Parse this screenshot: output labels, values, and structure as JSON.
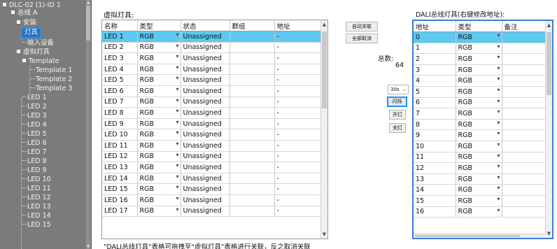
{
  "tree": {
    "root": "DLC-02 (1)-ID 1",
    "bus": "总线 A",
    "install": "安装",
    "fixture": "灯具",
    "input_device": "输入设备",
    "virtual_fixture": "虚拟灯具",
    "template": "Template",
    "templates": [
      "Template 1",
      "Template 2",
      "Template 3"
    ],
    "leds": [
      "LED 1",
      "LED 2",
      "LED 3",
      "LED 4",
      "LED 5",
      "LED 6",
      "LED 7",
      "LED 8",
      "LED 9",
      "LED 10",
      "LED 11",
      "LED 12",
      "LED 13",
      "LED 14",
      "LED 15"
    ]
  },
  "virtual_table": {
    "title": "虚拟灯具",
    "columns": [
      "名称",
      "类型",
      "状态",
      "群组",
      "地址"
    ],
    "rows": [
      {
        "name": "LED 1",
        "type": "RGB",
        "status": "Unassigned",
        "group": "",
        "address": "-"
      },
      {
        "name": "LED 2",
        "type": "RGB",
        "status": "Unassigned",
        "group": "",
        "address": "-"
      },
      {
        "name": "LED 3",
        "type": "RGB",
        "status": "Unassigned",
        "group": "",
        "address": "-"
      },
      {
        "name": "LED 4",
        "type": "RGB",
        "status": "Unassigned",
        "group": "",
        "address": "-"
      },
      {
        "name": "LED 5",
        "type": "RGB",
        "status": "Unassigned",
        "group": "",
        "address": "-"
      },
      {
        "name": "LED 6",
        "type": "RGB",
        "status": "Unassigned",
        "group": "",
        "address": "-"
      },
      {
        "name": "LED 7",
        "type": "RGB",
        "status": "Unassigned",
        "group": "",
        "address": "-"
      },
      {
        "name": "LED 8",
        "type": "RGB",
        "status": "Unassigned",
        "group": "",
        "address": "-"
      },
      {
        "name": "LED 9",
        "type": "RGB",
        "status": "Unassigned",
        "group": "",
        "address": "-"
      },
      {
        "name": "LED 10",
        "type": "RGB",
        "status": "Unassigned",
        "group": "",
        "address": "-"
      },
      {
        "name": "LED 11",
        "type": "RGB",
        "status": "Unassigned",
        "group": "",
        "address": "-"
      },
      {
        "name": "LED 12",
        "type": "RGB",
        "status": "Unassigned",
        "group": "",
        "address": "-"
      },
      {
        "name": "LED 13",
        "type": "RGB",
        "status": "Unassigned",
        "group": "",
        "address": "-"
      },
      {
        "name": "LED 14",
        "type": "RGB",
        "status": "Unassigned",
        "group": "",
        "address": "-"
      },
      {
        "name": "LED 15",
        "type": "RGB",
        "status": "Unassigned",
        "group": "",
        "address": "-"
      },
      {
        "name": "LED 16",
        "type": "RGB",
        "status": "Unassigned",
        "group": "",
        "address": "-"
      },
      {
        "name": "LED 17",
        "type": "RGB",
        "status": "Unassigned",
        "group": "",
        "address": "-"
      }
    ]
  },
  "footer_note": "\"DALI总线灯具\"表格可拖拽至\"虚拟灯具\"表格进行关联，反之取消关联",
  "controls": {
    "auto_link": "自动关联",
    "cancel_all": "全部取消",
    "total_label": "总数:",
    "total_value": "64",
    "interval": "30s",
    "flash": "闪烁",
    "turn_on": "开灯",
    "turn_off": "关灯"
  },
  "dali_table": {
    "title": "DALI总线灯具(右键修改地址):",
    "columns": [
      "地址",
      "类型",
      "备注"
    ],
    "rows": [
      {
        "address": "0",
        "type": "RGB",
        "note": ""
      },
      {
        "address": "1",
        "type": "RGB",
        "note": ""
      },
      {
        "address": "2",
        "type": "RGB",
        "note": ""
      },
      {
        "address": "3",
        "type": "RGB",
        "note": ""
      },
      {
        "address": "4",
        "type": "RGB",
        "note": ""
      },
      {
        "address": "5",
        "type": "RGB",
        "note": ""
      },
      {
        "address": "6",
        "type": "RGB",
        "note": ""
      },
      {
        "address": "7",
        "type": "RGB",
        "note": ""
      },
      {
        "address": "8",
        "type": "RGB",
        "note": ""
      },
      {
        "address": "9",
        "type": "RGB",
        "note": ""
      },
      {
        "address": "10",
        "type": "RGB",
        "note": ""
      },
      {
        "address": "11",
        "type": "RGB",
        "note": ""
      },
      {
        "address": "12",
        "type": "RGB",
        "note": ""
      },
      {
        "address": "13",
        "type": "RGB",
        "note": ""
      },
      {
        "address": "14",
        "type": "RGB",
        "note": ""
      },
      {
        "address": "15",
        "type": "RGB",
        "note": ""
      },
      {
        "address": "16",
        "type": "RGB",
        "note": ""
      }
    ]
  },
  "colors": {
    "selected_row": "#5dc9f0",
    "tree_bg": "#7b7b7b",
    "accent": "#2a8fe8"
  }
}
